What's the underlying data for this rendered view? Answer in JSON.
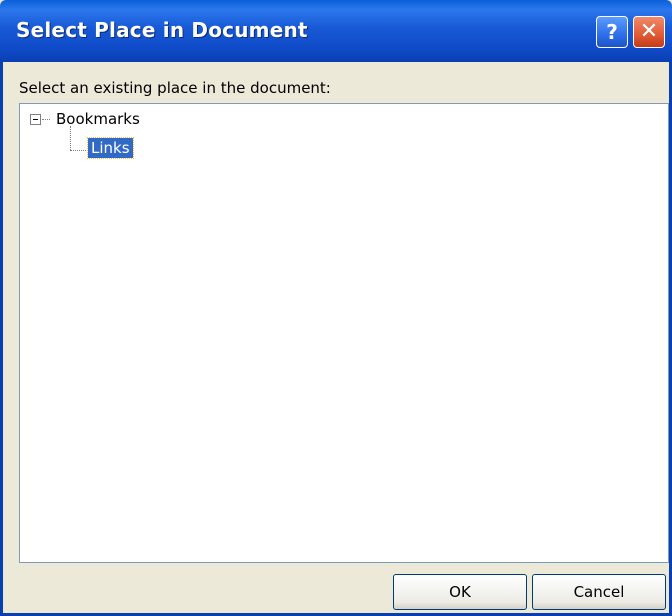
{
  "window": {
    "title": "Select Place in Document",
    "help_glyph": "?",
    "close_glyph": "✕"
  },
  "prompt": "Select an existing place in the document:",
  "tree": {
    "root": {
      "label": "Bookmarks",
      "expanded": true
    },
    "children": [
      {
        "label": "Links",
        "selected": true
      }
    ]
  },
  "buttons": {
    "ok": "OK",
    "cancel": "Cancel"
  },
  "colors": {
    "titlebar": "#0a5fd8",
    "selection": "#316ac5",
    "dialog_bg": "#ece9d8"
  }
}
